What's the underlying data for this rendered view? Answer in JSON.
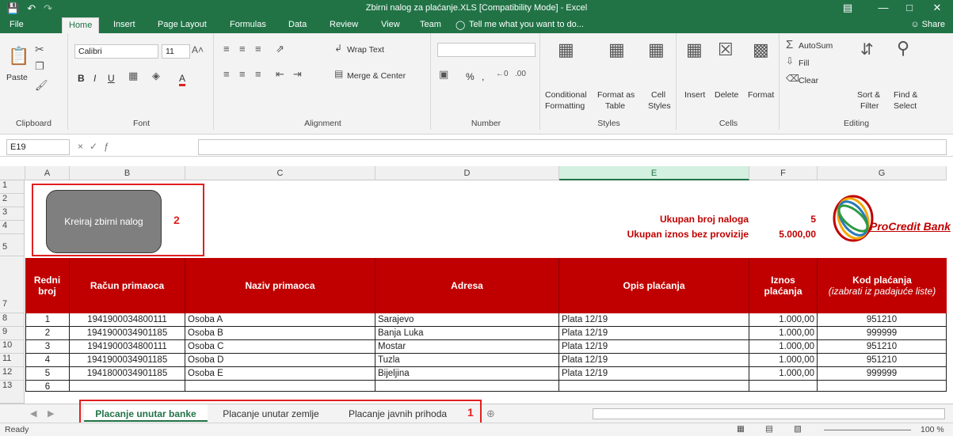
{
  "window": {
    "title": "Zbirni nalog za plaćanje.XLS  [Compatibility Mode] - Excel",
    "save_icon": "save-icon",
    "undo_icon": "undo-icon",
    "redo_icon": "redo-icon"
  },
  "tabs": [
    "File",
    "Home",
    "Insert",
    "Page Layout",
    "Formulas",
    "Data",
    "Review",
    "View",
    "Team"
  ],
  "tell_me": "Tell me what you want to do...",
  "share": "Share",
  "ribbon": {
    "clipboard": {
      "label": "Clipboard",
      "paste": "Paste"
    },
    "font": {
      "label": "Font",
      "name": "Calibri",
      "size": "11"
    },
    "alignment": {
      "label": "Alignment",
      "wrap": "Wrap Text",
      "merge": "Merge & Center"
    },
    "number": {
      "label": "Number",
      "format": ""
    },
    "styles": {
      "label": "Styles",
      "cond": "Conditional",
      "cond2": "Formatting",
      "table": "Format as",
      "table2": "Table",
      "cell": "Cell",
      "cell2": "Styles"
    },
    "cells": {
      "label": "Cells",
      "insert": "Insert",
      "delete": "Delete",
      "format": "Format"
    },
    "editing": {
      "label": "Editing",
      "autosum": "AutoSum",
      "fill": "Fill",
      "clear": "Clear",
      "sort": "Sort &",
      "sort2": "Filter",
      "find": "Find &",
      "find2": "Select"
    }
  },
  "formula_bar": {
    "name_box": "E19",
    "content": ""
  },
  "columns": [
    "A",
    "B",
    "C",
    "D",
    "E",
    "F",
    "G"
  ],
  "rows": [
    "1",
    "2",
    "3",
    "4",
    "5",
    "7",
    "8",
    "9",
    "10",
    "11",
    "12",
    "13"
  ],
  "macro_button": "Kreiraj zbirni nalog",
  "annotations": {
    "one": "1",
    "two": "2"
  },
  "summary": {
    "count_label": "Ukupan broj naloga",
    "count_value": "5",
    "total_label": "Ukupan iznos bez provizije",
    "total_value": "5.000,00"
  },
  "logo": {
    "text": "ProCredit Bank"
  },
  "table": {
    "headers": {
      "redni": "Redni",
      "broj": "broj",
      "racun": "Račun primaoca",
      "naziv": "Naziv primaoca",
      "adresa": "Adresa",
      "opis": "Opis plaćanja",
      "iznos1": "Iznos",
      "iznos2": "plaćanja",
      "kod": "Kod plaćanja",
      "kod_note": "(izabrati iz padajuće liste)"
    },
    "rows": [
      {
        "broj": "1",
        "racun": "1941900034800111",
        "naziv": "Osoba A",
        "adresa": "Sarajevo",
        "opis": "Plata 12/19",
        "iznos": "1.000,00",
        "kod": "951210"
      },
      {
        "broj": "2",
        "racun": "1941900034901185",
        "naziv": "Osoba B",
        "adresa": "Banja Luka",
        "opis": "Plata 12/19",
        "iznos": "1.000,00",
        "kod": "999999"
      },
      {
        "broj": "3",
        "racun": "1941900034800111",
        "naziv": "Osoba C",
        "adresa": "Mostar",
        "opis": "Plata 12/19",
        "iznos": "1.000,00",
        "kod": "951210"
      },
      {
        "broj": "4",
        "racun": "1941900034901185",
        "naziv": "Osoba D",
        "adresa": "Tuzla",
        "opis": "Plata 12/19",
        "iznos": "1.000,00",
        "kod": "951210"
      },
      {
        "broj": "5",
        "racun": "1941800034901185",
        "naziv": "Osoba E",
        "adresa": "Bijeljina",
        "opis": "Plata 12/19",
        "iznos": "1.000,00",
        "kod": "999999"
      },
      {
        "broj": "6",
        "racun": "",
        "naziv": "",
        "adresa": "",
        "opis": "",
        "iznos": "",
        "kod": ""
      }
    ]
  },
  "sheets": [
    "Placanje unutar banke",
    "Placanje unutar zemlje",
    "Placanje javnih prihoda"
  ],
  "status": {
    "ready": "Ready",
    "zoom": "100 %"
  },
  "colors": {
    "excel_green": "#217346",
    "header_red": "#c00000",
    "annotation_red": "#e02020"
  }
}
